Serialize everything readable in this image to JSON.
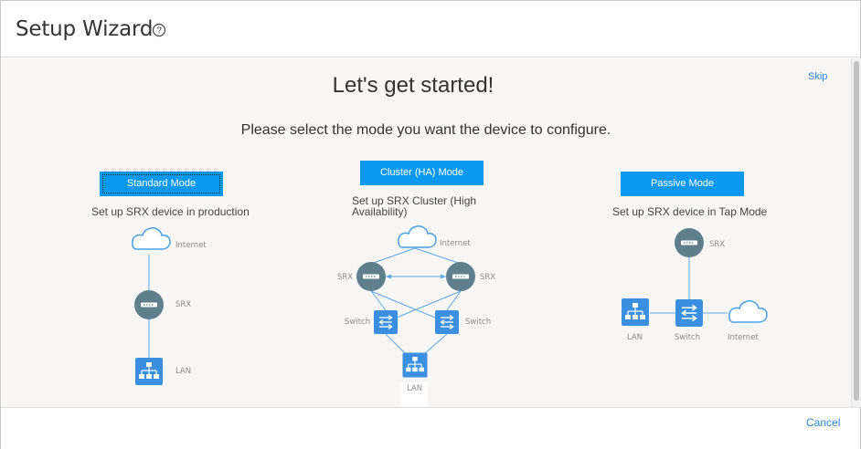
{
  "header": {
    "title": "Setup Wizard",
    "help_icon": "help-circle-icon"
  },
  "main": {
    "heading": "Let's get started!",
    "subheading": "Please select the mode you want the device to configure.",
    "skip_label": "Skip"
  },
  "modes": [
    {
      "button": "Standard Mode",
      "description": "Set up SRX device in production",
      "labels": {
        "internet": "Internet",
        "srx": "SRX",
        "lan": "LAN"
      }
    },
    {
      "button": "Cluster (HA) Mode",
      "description_line1": "Set up SRX Cluster (High",
      "description_line2": "Availability)",
      "labels": {
        "internet": "Internet",
        "srx_left": "SRX",
        "srx_right": "SRX",
        "switch_left": "Switch",
        "switch_right": "Switch",
        "lan": "LAN"
      }
    },
    {
      "button": "Passive Mode",
      "description": "Set up SRX device in Tap Mode",
      "labels": {
        "srx": "SRX",
        "lan": "LAN",
        "switch": "Switch",
        "internet": "Internet"
      }
    }
  ],
  "footer": {
    "cancel_label": "Cancel"
  },
  "colors": {
    "accent": "#0a98f0",
    "link": "#2a82d6",
    "device": "#5f7f8c",
    "switch": "#3a8fe0",
    "line": "#5aa8e8"
  }
}
